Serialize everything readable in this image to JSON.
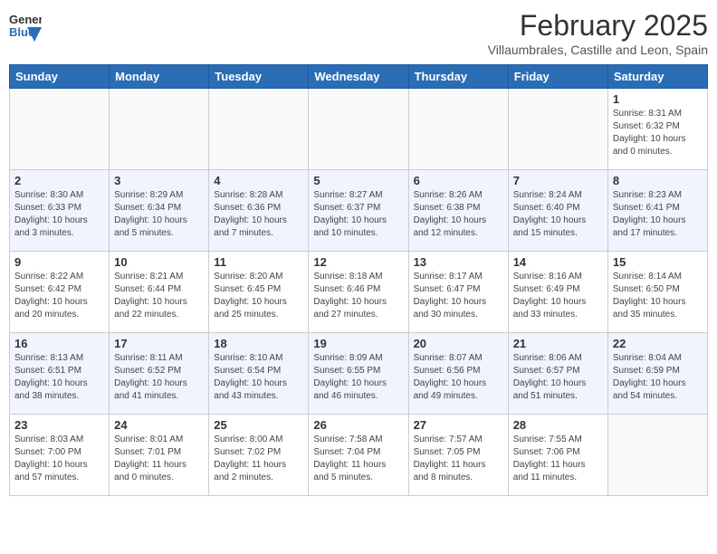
{
  "header": {
    "logo": {
      "general": "General",
      "blue": "Blue",
      "icon_shape": "triangle"
    },
    "title": "February 2025",
    "subtitle": "Villaumbrales, Castille and Leon, Spain"
  },
  "calendar": {
    "days_of_week": [
      "Sunday",
      "Monday",
      "Tuesday",
      "Wednesday",
      "Thursday",
      "Friday",
      "Saturday"
    ],
    "weeks": [
      [
        {
          "day": "",
          "info": ""
        },
        {
          "day": "",
          "info": ""
        },
        {
          "day": "",
          "info": ""
        },
        {
          "day": "",
          "info": ""
        },
        {
          "day": "",
          "info": ""
        },
        {
          "day": "",
          "info": ""
        },
        {
          "day": "1",
          "info": "Sunrise: 8:31 AM\nSunset: 6:32 PM\nDaylight: 10 hours\nand 0 minutes."
        }
      ],
      [
        {
          "day": "2",
          "info": "Sunrise: 8:30 AM\nSunset: 6:33 PM\nDaylight: 10 hours\nand 3 minutes."
        },
        {
          "day": "3",
          "info": "Sunrise: 8:29 AM\nSunset: 6:34 PM\nDaylight: 10 hours\nand 5 minutes."
        },
        {
          "day": "4",
          "info": "Sunrise: 8:28 AM\nSunset: 6:36 PM\nDaylight: 10 hours\nand 7 minutes."
        },
        {
          "day": "5",
          "info": "Sunrise: 8:27 AM\nSunset: 6:37 PM\nDaylight: 10 hours\nand 10 minutes."
        },
        {
          "day": "6",
          "info": "Sunrise: 8:26 AM\nSunset: 6:38 PM\nDaylight: 10 hours\nand 12 minutes."
        },
        {
          "day": "7",
          "info": "Sunrise: 8:24 AM\nSunset: 6:40 PM\nDaylight: 10 hours\nand 15 minutes."
        },
        {
          "day": "8",
          "info": "Sunrise: 8:23 AM\nSunset: 6:41 PM\nDaylight: 10 hours\nand 17 minutes."
        }
      ],
      [
        {
          "day": "9",
          "info": "Sunrise: 8:22 AM\nSunset: 6:42 PM\nDaylight: 10 hours\nand 20 minutes."
        },
        {
          "day": "10",
          "info": "Sunrise: 8:21 AM\nSunset: 6:44 PM\nDaylight: 10 hours\nand 22 minutes."
        },
        {
          "day": "11",
          "info": "Sunrise: 8:20 AM\nSunset: 6:45 PM\nDaylight: 10 hours\nand 25 minutes."
        },
        {
          "day": "12",
          "info": "Sunrise: 8:18 AM\nSunset: 6:46 PM\nDaylight: 10 hours\nand 27 minutes."
        },
        {
          "day": "13",
          "info": "Sunrise: 8:17 AM\nSunset: 6:47 PM\nDaylight: 10 hours\nand 30 minutes."
        },
        {
          "day": "14",
          "info": "Sunrise: 8:16 AM\nSunset: 6:49 PM\nDaylight: 10 hours\nand 33 minutes."
        },
        {
          "day": "15",
          "info": "Sunrise: 8:14 AM\nSunset: 6:50 PM\nDaylight: 10 hours\nand 35 minutes."
        }
      ],
      [
        {
          "day": "16",
          "info": "Sunrise: 8:13 AM\nSunset: 6:51 PM\nDaylight: 10 hours\nand 38 minutes."
        },
        {
          "day": "17",
          "info": "Sunrise: 8:11 AM\nSunset: 6:52 PM\nDaylight: 10 hours\nand 41 minutes."
        },
        {
          "day": "18",
          "info": "Sunrise: 8:10 AM\nSunset: 6:54 PM\nDaylight: 10 hours\nand 43 minutes."
        },
        {
          "day": "19",
          "info": "Sunrise: 8:09 AM\nSunset: 6:55 PM\nDaylight: 10 hours\nand 46 minutes."
        },
        {
          "day": "20",
          "info": "Sunrise: 8:07 AM\nSunset: 6:56 PM\nDaylight: 10 hours\nand 49 minutes."
        },
        {
          "day": "21",
          "info": "Sunrise: 8:06 AM\nSunset: 6:57 PM\nDaylight: 10 hours\nand 51 minutes."
        },
        {
          "day": "22",
          "info": "Sunrise: 8:04 AM\nSunset: 6:59 PM\nDaylight: 10 hours\nand 54 minutes."
        }
      ],
      [
        {
          "day": "23",
          "info": "Sunrise: 8:03 AM\nSunset: 7:00 PM\nDaylight: 10 hours\nand 57 minutes."
        },
        {
          "day": "24",
          "info": "Sunrise: 8:01 AM\nSunset: 7:01 PM\nDaylight: 11 hours\nand 0 minutes."
        },
        {
          "day": "25",
          "info": "Sunrise: 8:00 AM\nSunset: 7:02 PM\nDaylight: 11 hours\nand 2 minutes."
        },
        {
          "day": "26",
          "info": "Sunrise: 7:58 AM\nSunset: 7:04 PM\nDaylight: 11 hours\nand 5 minutes."
        },
        {
          "day": "27",
          "info": "Sunrise: 7:57 AM\nSunset: 7:05 PM\nDaylight: 11 hours\nand 8 minutes."
        },
        {
          "day": "28",
          "info": "Sunrise: 7:55 AM\nSunset: 7:06 PM\nDaylight: 11 hours\nand 11 minutes."
        },
        {
          "day": "",
          "info": ""
        }
      ]
    ]
  }
}
